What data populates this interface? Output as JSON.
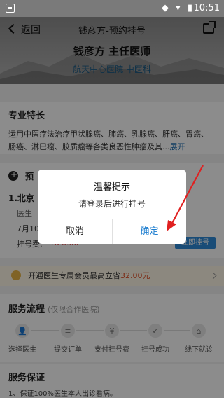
{
  "status_bar": {
    "time": "10:51",
    "sys_icons": "◆ ▾ ▮"
  },
  "header": {
    "back_label": "返回",
    "nav_title": "钱彦方-预约挂号",
    "doctor_name": "钱彦方 主任医师",
    "hospital": "航天中心医院 中医科"
  },
  "specialty": {
    "title": "专业特长",
    "desc": "运用中医疗法治疗甲状腺癌、肺癌、乳腺癌、肝癌、胃癌、肠癌、淋巴瘤、胶质瘤等各类良恶性肿瘤及其...",
    "more": "展开"
  },
  "appointment": {
    "title": "预",
    "location": "1.北京",
    "doctor_row": "医生",
    "date": "7月10",
    "fee_label": "挂号费:",
    "fee": "320.00",
    "book_label": "立即挂号"
  },
  "member": {
    "text": "开通医生专属会员最高立省",
    "amount": "32.00元"
  },
  "flow": {
    "title": "服务流程",
    "subtitle": "(仅限合作医院)",
    "steps": [
      "选择医生",
      "提交订单",
      "支付挂号费",
      "挂号成功",
      "线下就诊"
    ]
  },
  "guarantee": {
    "title": "服务保证",
    "item1": "1、保证100%医生本人出诊看病。"
  },
  "dialog": {
    "title": "温馨提示",
    "message": "请登录后进行挂号",
    "cancel": "取消",
    "confirm": "确定"
  },
  "colors": {
    "accent": "#1f7fd0",
    "price": "#e2532b",
    "annotation": "#e02020"
  }
}
